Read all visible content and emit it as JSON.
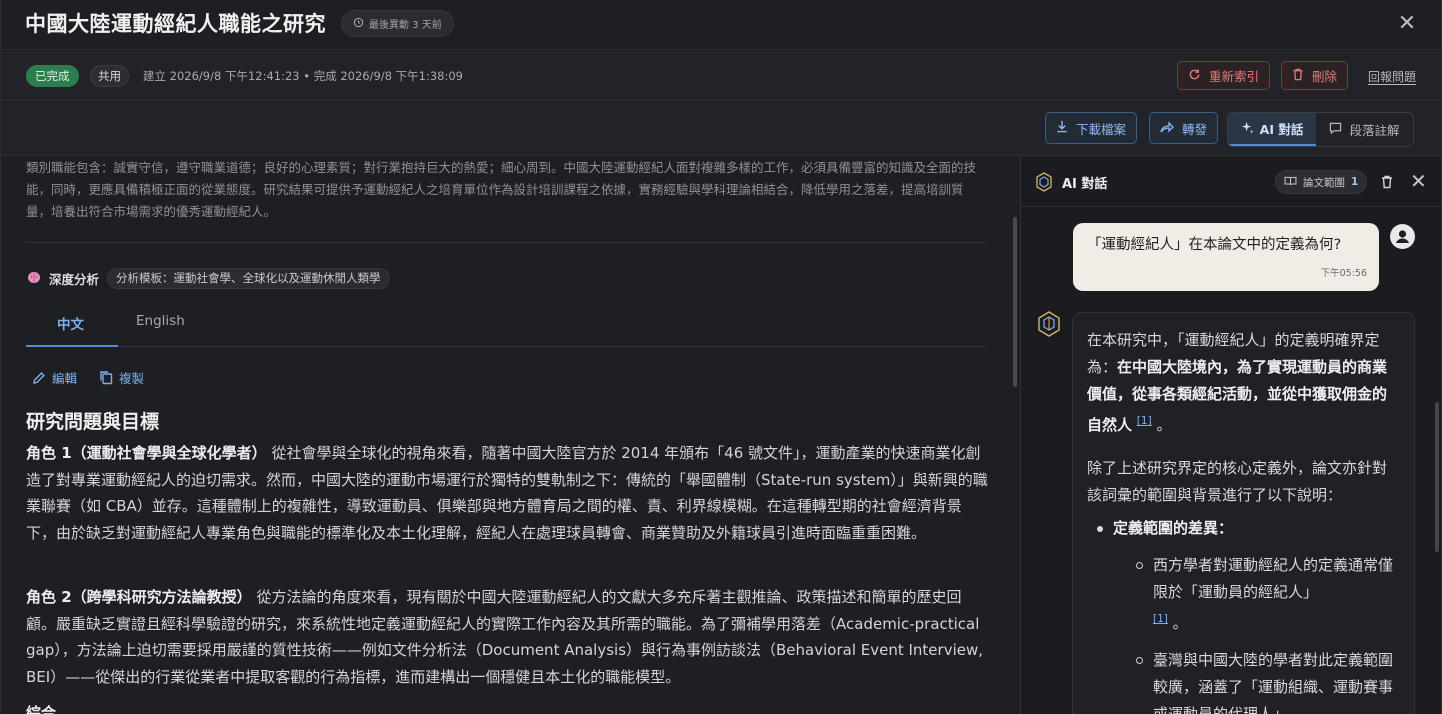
{
  "header": {
    "title": "中國大陸運動經紀人職能之研究",
    "last_activity": "最後異動 3 天前"
  },
  "meta": {
    "status": "已完成",
    "share": "共用",
    "dates": "建立 2026/9/8 下午12:41:23 • 完成 2026/9/8 下午1:38:09",
    "reindex": "重新索引",
    "delete": "刪除",
    "report": "回報問題"
  },
  "toolbar": {
    "download": "下載檔案",
    "forward": "轉發",
    "ai_chat": "AI 對話",
    "annotate": "段落註解"
  },
  "content": {
    "abstract": "類別職能包含：誠實守信，遵守職業道德；良好的心理素質；對行業抱持巨大的熱愛；細心周到。中國大陸運動經紀人面對複雜多樣的工作，必須具備豐富的知識及全面的技能，同時，更應具備積極正面的從業態度。研究結果可提供予運動經紀人之培育單位作為設計培訓課程之依據，實務經驗與學科理論相結合，降低學用之落差，提高培訓質量，培養出符合市場需求的優秀運動經紀人。",
    "deep_label": "深度分析",
    "template": "分析模板：運動社會學、全球化以及運動休閒人類學",
    "tab_zh": "中文",
    "tab_en": "English",
    "edit": "編輯",
    "copy": "複製",
    "heading": "研究問題與目標",
    "p1_lead": "角色 1（運動社會學與全球化學者）",
    "p1_body": " 從社會學與全球化的視角來看，隨著中國大陸官方於 2014 年頒布「46 號文件」，運動產業的快速商業化創造了對專業運動經紀人的迫切需求。然而，中國大陸的運動市場運行於獨特的雙軌制之下：傳統的「舉國體制（State-run system）」與新興的職業聯賽（如 CBA）並存。這種體制上的複雜性，導致運動員、俱樂部與地方體育局之間的權、責、利界線模糊。在這種轉型期的社會經濟背景下，由於缺乏對運動經紀人專業角色與職能的標準化及本土化理解，經紀人在處理球員轉會、商業贊助及外籍球員引進時面臨重重困難。",
    "p2_lead": "角色 2（跨學科研究方法論教授）",
    "p2_body": " 從方法論的角度來看，現有關於中國大陸運動經紀人的文獻大多充斥著主觀推論、政策描述和簡單的歷史回顧。嚴重缺乏實證且經科學驗證的研究，來系統性地定義運動經紀人的實際工作內容及其所需的職能。為了彌補學用落差（Academic-practical gap），方法論上迫切需要採用嚴謹的質性技術——例如文件分析法（Document Analysis）與行為事例訪談法（Behavioral Event Interview, BEI）——從傑出的行業從業者中提取客觀的行為指標，進而建構出一個穩健且本土化的職能模型。",
    "h3": "綜合"
  },
  "chat": {
    "title": "AI 對話",
    "scope_label": "論文範圍",
    "scope_count": "1",
    "user_msg": "「運動經紀人」在本論文中的定義為何?",
    "user_time": "下午05:56",
    "a1_pre": "在本研究中，「運動經紀人」的定義明確界定為：",
    "a1_bold": "在中國大陸境內，為了實現運動員的商業價值，從事各類經紀活動，並從中獲取佣金的自然人",
    "cite": "[1]",
    "a1_end": "。",
    "a2": "除了上述研究界定的核心定義外，論文亦針對該詞彙的範圍與背景進行了以下說明：",
    "bullet1": "定義範圍的差異：",
    "sub1": "西方學者對運動經紀人的定義通常僅限於「運動員的經紀人」",
    "sub1_end": "。",
    "sub2": "臺灣與中國大陸的學者對此定義範圍較廣，涵蓋了「運動組織、運動賽事或運動員的代理人」"
  }
}
